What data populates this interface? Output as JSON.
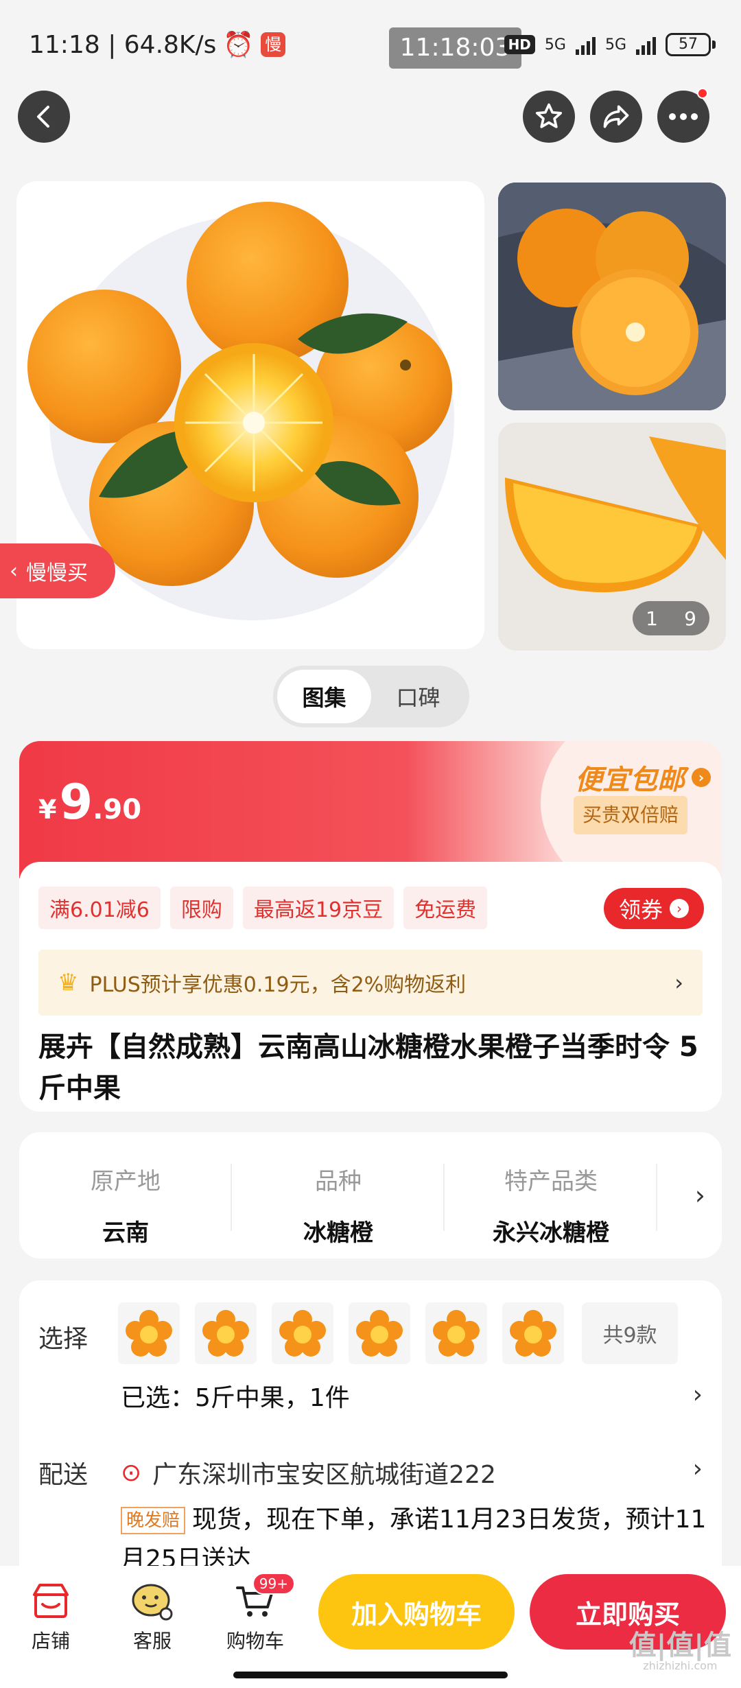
{
  "status_bar": {
    "left_text": "11:18 | 64.8K/s",
    "app_icon_text": "慢",
    "center_time": "11:18:03",
    "hd": "HD",
    "net1": "5G",
    "net2": "5G",
    "battery": "57"
  },
  "gallery": {
    "counter_current": "1",
    "counter_total": "9",
    "slow_buy_label": "慢慢买"
  },
  "tabs": [
    "图集",
    "口碑"
  ],
  "price": {
    "currency": "¥",
    "integer": "9",
    "decimal": ".90",
    "promo_title": "便宜包邮",
    "guarantee": "买贵双倍赔"
  },
  "promo_tags": [
    "满6.01减6",
    "限购",
    "最高返19京豆",
    "免运费"
  ],
  "coupon_button": "领券",
  "plus": {
    "text": "PLUS预计享优惠0.19元，含2%购物返利"
  },
  "product": {
    "title": "展卉【自然成熟】云南高山冰糖橙水果橙子当季时令 5斤中果"
  },
  "attributes": [
    {
      "label": "原产地",
      "value": "云南"
    },
    {
      "label": "品种",
      "value": "冰糖橙"
    },
    {
      "label": "特产品类",
      "value": "永兴冰糖橙"
    }
  ],
  "selection": {
    "label": "选择",
    "more": "共9款",
    "selected": "已选：5斤中果，1件"
  },
  "delivery": {
    "label": "配送",
    "address": "广东深圳市宝安区航城街道222",
    "late_tag": "晚发赔",
    "info": "现货，现在下单，承诺11月23日发货，预计11月25日送达"
  },
  "bottom_bar": {
    "shop": "店铺",
    "service": "客服",
    "cart": "购物车",
    "cart_badge": "99+",
    "add_to_cart": "加入购物车",
    "buy_now": "立即购买"
  },
  "watermark": {
    "main": "值|值|值",
    "sub": "zhizhizhi.com"
  },
  "colors": {
    "brand_red": "#ec2c43",
    "cart_yellow": "#fdc410",
    "promo_orange": "#ef8a1a"
  }
}
